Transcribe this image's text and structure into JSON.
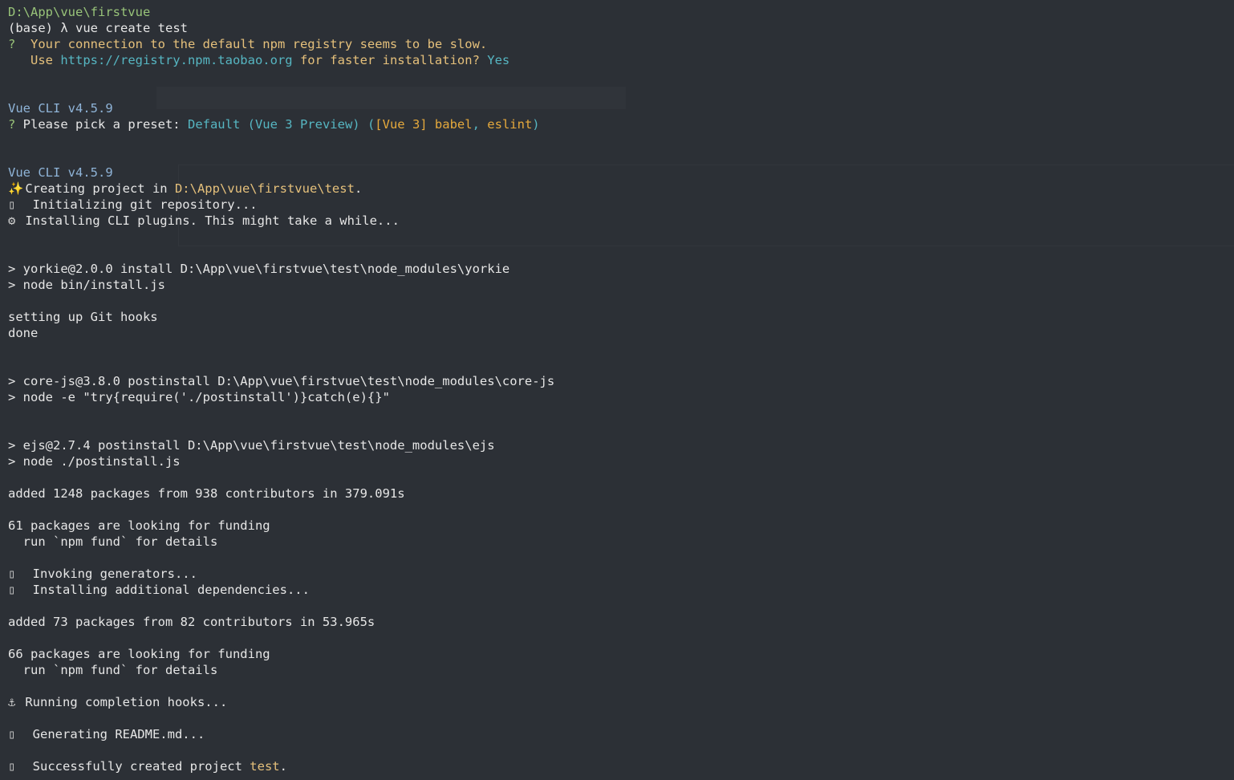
{
  "terminal": {
    "cwd": "D:\\App\\vue\\firstvue",
    "prompt": "(base) λ ",
    "command": "vue create test",
    "q1_mark": "?  ",
    "q1_text": "Your connection to the default npm registry seems to be slow.",
    "q1_use_prefix": "   Use ",
    "q1_url": "https://registry.npm.taobao.org",
    "q1_suffix": " for faster installation? ",
    "q1_answer": "Yes",
    "cli_version_1": "Vue CLI v4.5.9",
    "q2_mark": "? ",
    "q2_text": "Please pick a preset: ",
    "q2_answer_a": "Default (Vue 3 Preview) (",
    "q2_answer_b": "[Vue 3] babel",
    "q2_answer_c": ", ",
    "q2_answer_d": "eslint",
    "q2_answer_e": ")",
    "cli_version_2": "Vue CLI v4.5.9",
    "creating_prefix": " Creating project in ",
    "creating_path": "D:\\App\\vue\\firstvue\\test",
    "creating_suffix": ".",
    "init_git": "  Initializing git repository...",
    "installing_plugins": " Installing CLI plugins. This might take a while...",
    "yorkie_install": "> yorkie@2.0.0 install D:\\App\\vue\\firstvue\\test\\node_modules\\yorkie",
    "yorkie_node": "> node bin/install.js",
    "git_hooks": "setting up Git hooks",
    "done": "done",
    "corejs_install": "> core-js@3.8.0 postinstall D:\\App\\vue\\firstvue\\test\\node_modules\\core-js",
    "corejs_node": "> node -e \"try{require('./postinstall')}catch(e){}\"",
    "ejs_install": "> ejs@2.7.4 postinstall D:\\App\\vue\\firstvue\\test\\node_modules\\ejs",
    "ejs_node": "> node ./postinstall.js",
    "added_1": "added 1248 packages from 938 contributors in 379.091s",
    "funding_1": "61 packages are looking for funding",
    "fund_details_1": "  run `npm fund` for details",
    "invoking": "  Invoking generators...",
    "installing_deps": "  Installing additional dependencies...",
    "added_2": "added 73 packages from 82 contributors in 53.965s",
    "funding_2": "66 packages are looking for funding",
    "fund_details_2": "  run `npm fund` for details",
    "completion_hooks": " Running completion hooks...",
    "readme": "  Generating README.md...",
    "success_prefix": "  Successfully created project ",
    "success_name": "test",
    "success_suffix": "."
  },
  "icons": {
    "creating": "sparkle-icon",
    "init_git": "unknown-glyph-icon",
    "installing_plugins": "gear-icon",
    "invoking": "unknown-glyph-icon",
    "installing_deps": "unknown-glyph-icon",
    "completion_hooks": "anchor-icon",
    "readme": "unknown-glyph-icon",
    "success": "unknown-glyph-icon"
  },
  "colors": {
    "background": "#2c3036",
    "path": "#98c379",
    "question": "#e5c07b",
    "url": "#56b6c2",
    "answer": "#56b6c2",
    "vue_version": "#8fb4d8",
    "preset_detail": "#e5a93c"
  }
}
